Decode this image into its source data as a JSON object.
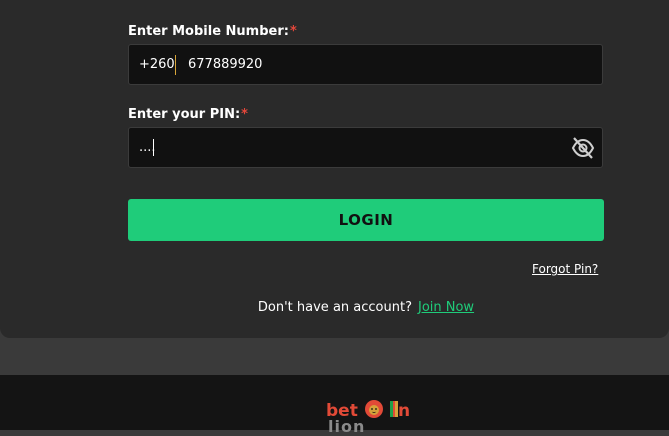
{
  "form": {
    "mobile_label": "Enter Mobile Number:",
    "mobile_required": "*",
    "country_code": "+260",
    "mobile_value": "677889920",
    "pin_label": "Enter your PIN:",
    "pin_required": "*",
    "pin_value": "....",
    "pin_visibility_icon": "eye-off-icon",
    "login_label": "LOGIN",
    "forgot_label": "Forgot Pin?",
    "no_account_text": "Don't have an account?",
    "join_label": "Join Now"
  },
  "footer": {
    "logo_text": "bet",
    "logo_suffix": "n",
    "logo_sub": "lion"
  },
  "colors": {
    "accent": "#1fcc7a",
    "required": "#e5473b",
    "panel": "#2a2a2a",
    "input_bg": "#111111",
    "logo_red": "#e24a37"
  }
}
